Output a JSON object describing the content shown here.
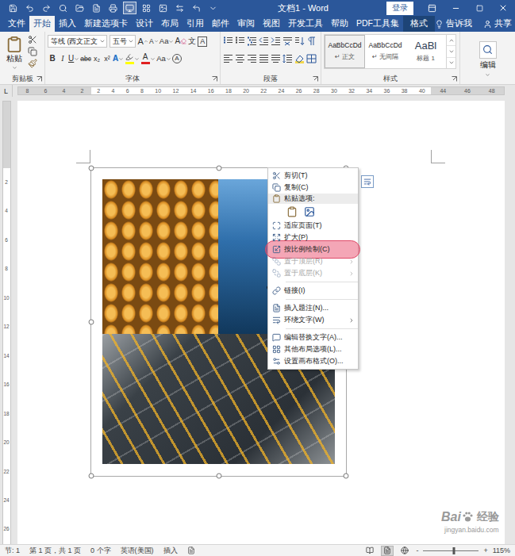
{
  "titleBar": {
    "title": "文档1 - Word",
    "login": "登录",
    "quickAccess": [
      {
        "selected": false
      },
      {
        "selected": false
      },
      {
        "selected": false
      },
      {
        "selected": false
      },
      {
        "selected": false
      },
      {
        "selected": false
      },
      {
        "selected": false
      },
      {
        "selected": true
      },
      {
        "selected": false
      },
      {
        "selected": false
      },
      {
        "selected": false
      },
      {
        "selected": false
      },
      {
        "selected": false
      }
    ]
  },
  "tabs": [
    {
      "label": "文件",
      "selected": false,
      "contextual": false
    },
    {
      "label": "开始",
      "selected": true,
      "contextual": false
    },
    {
      "label": "插入",
      "selected": false,
      "contextual": false
    },
    {
      "label": "新建选项卡",
      "selected": false,
      "contextual": false
    },
    {
      "label": "设计",
      "selected": false,
      "contextual": false
    },
    {
      "label": "布局",
      "selected": false,
      "contextual": false
    },
    {
      "label": "引用",
      "selected": false,
      "contextual": false
    },
    {
      "label": "邮件",
      "selected": false,
      "contextual": false
    },
    {
      "label": "审阅",
      "selected": false,
      "contextual": false
    },
    {
      "label": "视图",
      "selected": false,
      "contextual": false
    },
    {
      "label": "开发工具",
      "selected": false,
      "contextual": false
    },
    {
      "label": "帮助",
      "selected": false,
      "contextual": false
    },
    {
      "label": "PDF工具集",
      "selected": false,
      "contextual": false
    },
    {
      "label": "格式",
      "selected": false,
      "contextual": true
    }
  ],
  "tellMe": "告诉我",
  "share": "共享",
  "ribbon": {
    "clipboard": {
      "label": "剪贴板",
      "paste": "粘贴"
    },
    "font": {
      "label": "字体",
      "fontName": "等线 (西文正文",
      "fontSize": "五号",
      "row1": [
        {
          "glyph": "A",
          "kind": "grow",
          "dropdown": false
        },
        {
          "glyph": "A",
          "kind": "shrink",
          "dropdown": false
        },
        {
          "glyph": "Aa",
          "kind": "case",
          "dropdown": true
        },
        {
          "glyph": "A",
          "kind": "clear",
          "dropdown": false
        },
        {
          "glyph": "文",
          "kind": "phonetic",
          "dropdown": false
        },
        {
          "glyph": "A",
          "kind": "border",
          "dropdown": false
        }
      ],
      "row2": [
        {
          "glyph": "B",
          "kind": "bold",
          "dropdown": false
        },
        {
          "glyph": "I",
          "kind": "italic",
          "dropdown": false
        },
        {
          "glyph": "U",
          "kind": "underline",
          "dropdown": true
        },
        {
          "glyph": "abc",
          "kind": "strike",
          "dropdown": false
        },
        {
          "glyph": "x₂",
          "kind": "sub",
          "dropdown": false
        },
        {
          "glyph": "x²",
          "kind": "sup",
          "dropdown": false
        },
        {
          "glyph": "A",
          "kind": "effects",
          "dropdown": true
        },
        {
          "glyph": "",
          "kind": "highlight",
          "dropdown": true,
          "color": "#ffff00"
        },
        {
          "glyph": "A",
          "kind": "color",
          "dropdown": true,
          "color": "#e02020"
        },
        {
          "glyph": "Aa",
          "kind": "size",
          "dropdown": true
        },
        {
          "glyph": "A",
          "kind": "enclose",
          "dropdown": false
        }
      ]
    },
    "paragraph": {
      "label": "段落"
    },
    "styles": {
      "label": "样式",
      "items": [
        {
          "preview": "AaBbCcDd",
          "name": "↵ 正文",
          "selected": true,
          "heading": false
        },
        {
          "preview": "AaBbCcDd",
          "name": "↵ 无间隔",
          "selected": false,
          "heading": false
        },
        {
          "preview": "AaBl",
          "name": "标题 1",
          "selected": false,
          "heading": true
        }
      ]
    },
    "editing": {
      "label": "编辑"
    }
  },
  "ruler": {
    "selector": "L",
    "left": [
      "8",
      "6",
      "4",
      "2"
    ],
    "main": [
      "2",
      "4",
      "6",
      "8",
      "10",
      "12",
      "14",
      "16",
      "18",
      "20",
      "22",
      "24",
      "26",
      "28",
      "30",
      "32",
      "34",
      "36",
      "38",
      "40"
    ],
    "right": [
      "44",
      "46",
      "48"
    ]
  },
  "verticalRuler": [
    "2",
    "4",
    "6",
    "8",
    "10",
    "12",
    "14",
    "16",
    "18",
    "20",
    "22",
    "24",
    "26"
  ],
  "canvas": {
    "selected": true
  },
  "contextMenu": {
    "items": [
      {
        "kind": "item",
        "label": "剪切(T)",
        "disabled": false,
        "submenu": false,
        "highlighted": false
      },
      {
        "kind": "item",
        "label": "复制(C)",
        "disabled": false,
        "submenu": false,
        "highlighted": false
      },
      {
        "kind": "header",
        "label": "粘贴选项:"
      },
      {
        "kind": "paste-icons"
      },
      {
        "kind": "item",
        "label": "适应页面(T)",
        "disabled": false,
        "submenu": false,
        "highlighted": false
      },
      {
        "kind": "item",
        "label": "扩大(P)",
        "disabled": false,
        "submenu": false,
        "highlighted": false
      },
      {
        "kind": "item",
        "label": "按比例绘制(C)",
        "disabled": false,
        "submenu": false,
        "highlighted": true
      },
      {
        "kind": "item",
        "label": "置于顶层(R)",
        "disabled": true,
        "submenu": true,
        "highlighted": false
      },
      {
        "kind": "item",
        "label": "置于底层(K)",
        "disabled": true,
        "submenu": true,
        "highlighted": false
      },
      {
        "kind": "separator"
      },
      {
        "kind": "item",
        "label": "链接(I)",
        "disabled": false,
        "submenu": false,
        "highlighted": false
      },
      {
        "kind": "separator"
      },
      {
        "kind": "item",
        "label": "插入题注(N)...",
        "disabled": false,
        "submenu": false,
        "highlighted": false
      },
      {
        "kind": "item",
        "label": "环绕文字(W)",
        "disabled": false,
        "submenu": true,
        "highlighted": false
      },
      {
        "kind": "separator"
      },
      {
        "kind": "item",
        "label": "编辑替换文字(A)...",
        "disabled": false,
        "submenu": false,
        "highlighted": false
      },
      {
        "kind": "item",
        "label": "其他布局选项(L)...",
        "disabled": false,
        "submenu": false,
        "highlighted": false
      },
      {
        "kind": "item",
        "label": "设置画布格式(O)...",
        "disabled": false,
        "submenu": false,
        "highlighted": false
      }
    ]
  },
  "statusBar": {
    "left": [
      "节: 1",
      "第 1 页，共 1 页",
      "0 个字",
      "英语(美国)",
      "插入"
    ],
    "views": [
      {
        "selected": false
      },
      {
        "selected": true
      },
      {
        "selected": false
      }
    ],
    "zoomMinus": "-",
    "zoomPlus": "+",
    "zoomLevel": 0.55,
    "zoom": "115%"
  },
  "watermark": {
    "brand": "Bai",
    "brand2": "经验",
    "url": "jingyan.baidu.com"
  }
}
